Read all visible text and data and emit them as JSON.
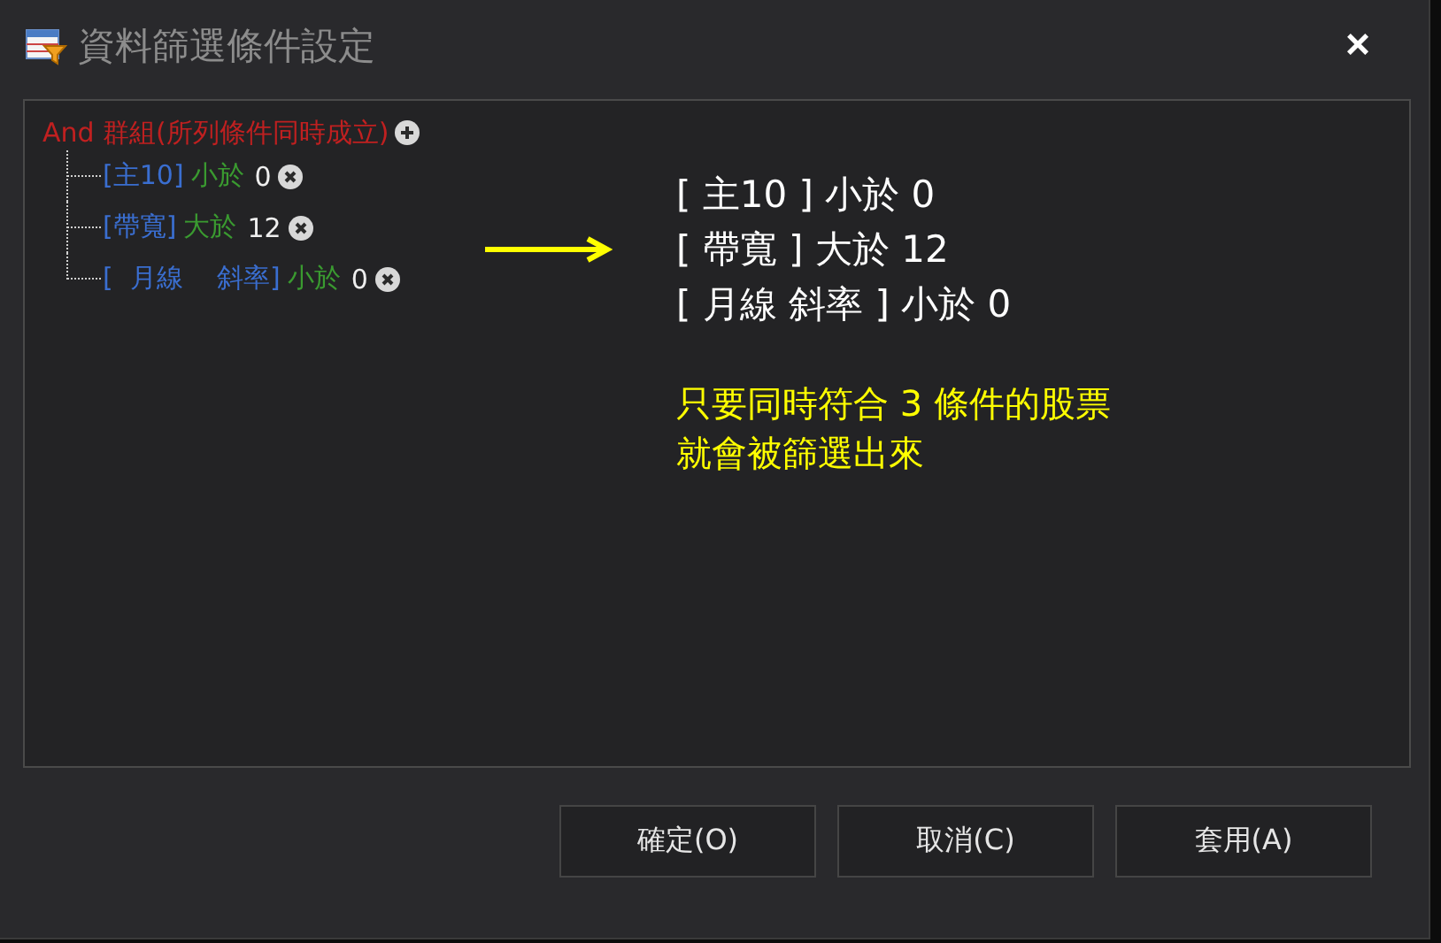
{
  "window": {
    "title": "資料篩選條件設定",
    "close": "×"
  },
  "tree": {
    "label": "And 群組(所列條件同時成立)",
    "children": [
      {
        "field": "[主10]",
        "op": "小於",
        "value": "0"
      },
      {
        "field": "[帶寬]",
        "op": "大於",
        "value": "12"
      },
      {
        "field": "[  月線    斜率]",
        "op": "小於",
        "value": "0"
      }
    ]
  },
  "annotation": {
    "conditions": [
      "[ 主10 ] 小於 0",
      "[ 帶寬 ] 大於 12",
      "[ 月線 斜率 ] 小於 0"
    ],
    "note": [
      "只要同時符合 3 條件的股票",
      "就會被篩選出來"
    ]
  },
  "buttons": [
    "確定(O)",
    "取消(C)",
    "套用(A)"
  ]
}
